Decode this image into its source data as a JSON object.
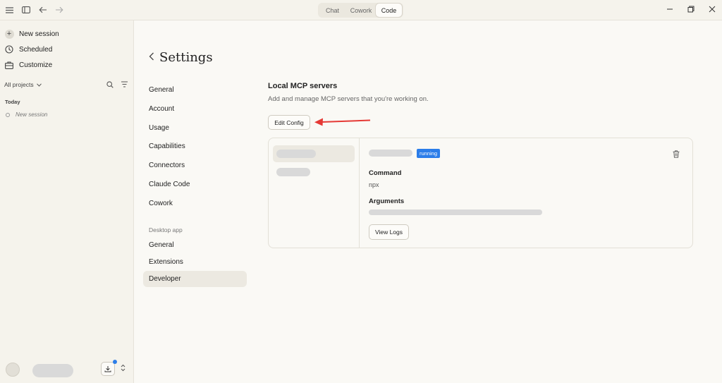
{
  "titlebar": {
    "tabs": [
      {
        "label": "Chat"
      },
      {
        "label": "Cowork"
      },
      {
        "label": "Code"
      }
    ],
    "active_tab": "Code"
  },
  "sidebar": {
    "new_session": "New session",
    "scheduled": "Scheduled",
    "customize": "Customize",
    "projects_filter": "All projects",
    "group_label": "Today",
    "sessions": [
      {
        "label": "New session"
      }
    ]
  },
  "settings": {
    "title": "Settings",
    "nav": [
      {
        "label": "General"
      },
      {
        "label": "Account"
      },
      {
        "label": "Usage"
      },
      {
        "label": "Capabilities"
      },
      {
        "label": "Connectors"
      },
      {
        "label": "Claude Code"
      },
      {
        "label": "Cowork"
      }
    ],
    "desktop_section_label": "Desktop app",
    "desktop_nav": [
      {
        "label": "General"
      },
      {
        "label": "Extensions"
      },
      {
        "label": "Developer"
      }
    ],
    "active_nav": "Developer"
  },
  "mcp": {
    "title": "Local MCP servers",
    "subtitle": "Add and manage MCP servers that you're working on.",
    "edit_config_label": "Edit Config",
    "status": "running",
    "command_label": "Command",
    "command_value": "npx",
    "arguments_label": "Arguments",
    "view_logs_label": "View Logs"
  },
  "colors": {
    "accent_blue": "#2b7de9",
    "annotation_arrow": "#e53935",
    "background": "#faf9f5"
  }
}
